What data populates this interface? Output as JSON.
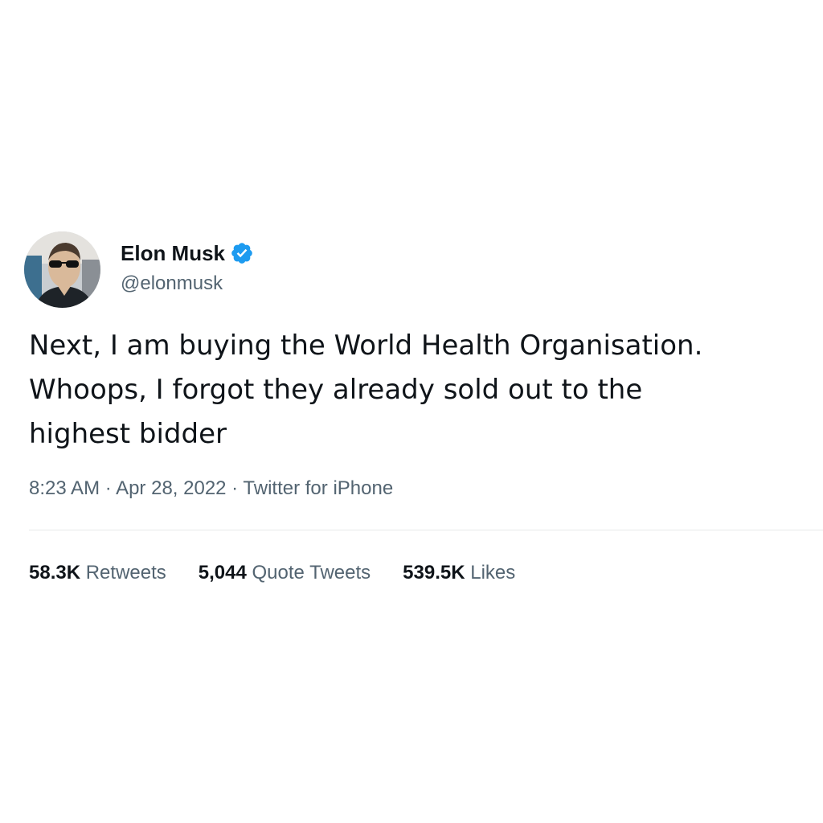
{
  "author": {
    "display_name": "Elon Musk",
    "handle": "@elonmusk",
    "verified": true,
    "verified_color": "#1d9bf0"
  },
  "tweet": {
    "text_lines": [
      "Next, I am buying the World Health Organisation.",
      "Whoops, I forgot they already sold out to the",
      "highest bidder"
    ],
    "time": "8:23 AM",
    "date": "Apr 28, 2022",
    "source": "Twitter for iPhone",
    "separator": " · "
  },
  "stats": {
    "retweets": {
      "count": "58.3K",
      "label": "Retweets"
    },
    "quote_tweets": {
      "count": "5,044",
      "label": "Quote Tweets"
    },
    "likes": {
      "count": "539.5K",
      "label": "Likes"
    }
  },
  "colors": {
    "text_primary": "#0f1419",
    "text_secondary": "#536471",
    "divider": "#e7e9ea",
    "background": "#ffffff"
  }
}
